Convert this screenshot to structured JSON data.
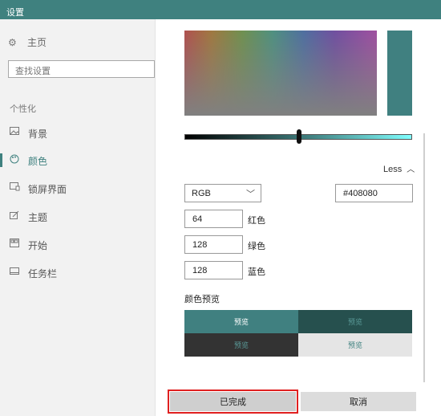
{
  "window": {
    "title": "设置"
  },
  "sidebar": {
    "home": {
      "label": "主页",
      "icon": "gear-icon"
    },
    "search": {
      "placeholder": "查找设置"
    },
    "section_title": "个性化",
    "items": [
      {
        "label": "背景",
        "icon": "image-icon"
      },
      {
        "label": "颜色",
        "icon": "palette-icon",
        "active": true
      },
      {
        "label": "锁屏界面",
        "icon": "lock-screen-icon"
      },
      {
        "label": "主题",
        "icon": "brush-icon"
      },
      {
        "label": "开始",
        "icon": "start-grid-icon"
      },
      {
        "label": "任务栏",
        "icon": "taskbar-icon"
      }
    ]
  },
  "picker": {
    "selected_color": "#408080",
    "less_label": "Less",
    "model": "RGB",
    "hex": "#408080",
    "channels": [
      {
        "value": "64",
        "label": "红色"
      },
      {
        "value": "128",
        "label": "绿色"
      },
      {
        "value": "128",
        "label": "蓝色"
      }
    ],
    "slider_fraction": 0.5
  },
  "preview": {
    "title": "颜色预览",
    "cells": [
      {
        "text": "预览",
        "bg": "#408080",
        "fg": "#ffffff"
      },
      {
        "text": "预览",
        "bg": "#26504e",
        "fg": "#5a9a98"
      },
      {
        "text": "预览",
        "bg": "#333333",
        "fg": "#5a9a98"
      },
      {
        "text": "预览",
        "bg": "#e5e5e5",
        "fg": "#3f817f"
      }
    ]
  },
  "buttons": {
    "done": "已完成",
    "cancel": "取消"
  }
}
